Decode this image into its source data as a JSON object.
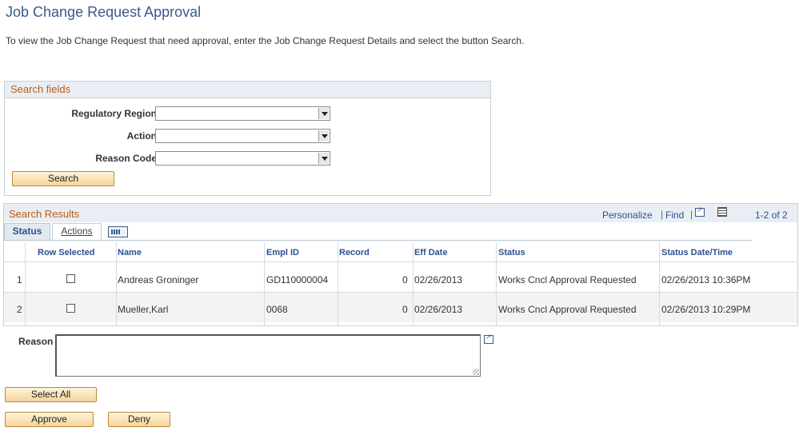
{
  "page": {
    "title": "Job Change Request Approval",
    "instructions": "To view the Job Change Request that need approval, enter the Job Change Request Details and select the button Search."
  },
  "search": {
    "header": "Search fields",
    "fields": [
      {
        "label": "Regulatory Region",
        "value": ""
      },
      {
        "label": "Action",
        "value": ""
      },
      {
        "label": "Reason Code",
        "value": ""
      }
    ],
    "button": "Search"
  },
  "results": {
    "header": "Search Results",
    "personalize": "Personalize",
    "find": "Find",
    "count": "1-2 of 2",
    "tabs": [
      "Status",
      "Actions"
    ],
    "columns": [
      "Row Selected",
      "Name",
      "Empl ID",
      "Record",
      "Eff Date",
      "Status",
      "Status Date/Time"
    ],
    "rows": [
      {
        "num": "1",
        "name": "Andreas Groninger",
        "empl_id": "GD110000004",
        "record": "0",
        "eff_date": "02/26/2013",
        "status": "Works Cncl Approval Requested",
        "status_dt": "02/26/2013 10:36PM"
      },
      {
        "num": "2",
        "name": "Mueller,Karl",
        "empl_id": "0068",
        "record": "0",
        "eff_date": "02/26/2013",
        "status": "Works Cncl Approval Requested",
        "status_dt": "02/26/2013 10:29PM"
      }
    ]
  },
  "reason": {
    "label": "Reason",
    "value": ""
  },
  "buttons": {
    "select_all": "Select All",
    "approve": "Approve",
    "deny": "Deny"
  }
}
